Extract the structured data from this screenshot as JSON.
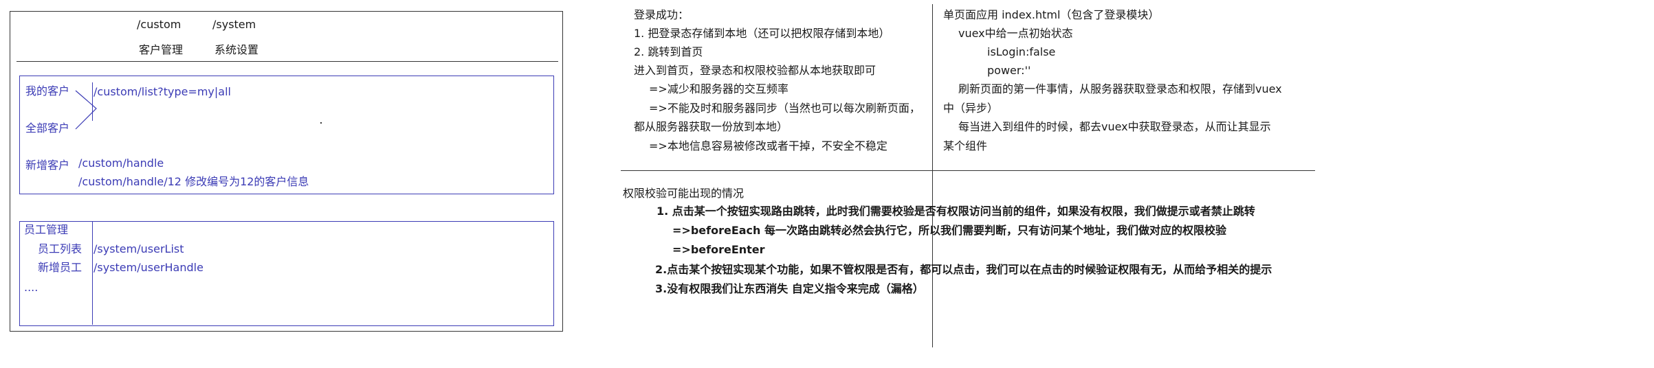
{
  "left_sketch": {
    "header_paths": [
      "/custom",
      "/system"
    ],
    "header_labels": [
      "客户管理",
      "系统设置"
    ],
    "customer_panel": {
      "nav": [
        "我的客户",
        "全部客户",
        "新增客户"
      ],
      "routes": [
        "/custom/list?type=my|all",
        "/custom/handle",
        "/custom/handle/12   修改编号为12的客户信息"
      ]
    },
    "staff_panel": {
      "nav": [
        "员工管理",
        "员工列表",
        "新增员工",
        "...."
      ],
      "routes": [
        "/system/userList",
        "/system/userHandle"
      ]
    }
  },
  "notes_left": [
    "登录成功：",
    "1. 把登录态存储到本地（还可以把权限存储到本地）",
    "2. 跳转到首页",
    "进入到首页，登录态和权限校验都从本地获取即可",
    "=>减少和服务器的交互频率",
    "=>不能及时和服务器同步（当然也可以每次刷新页面，",
    "都从服务器获取一份放到本地）",
    "=>本地信息容易被修改或者干掉，不安全不稳定"
  ],
  "notes_right": [
    "单页面应用    index.html（包含了登录模块）",
    "vuex中给一点初始状态",
    "isLogin:false",
    "power:''",
    "刷新页面的第一件事情，从服务器获取登录态和权限，存储到vuex",
    "中（异步）",
    "每当进入到组件的时候，都去vuex中获取登录态，从而让其显示",
    "某个组件"
  ],
  "notes_bottom": {
    "heading": "权限校验可能出现的情况",
    "lines": [
      "1. 点击某一个按钮实现路由跳转，此时我们需要校验是否有权限访问当前的组件，如果没有权限，我们做提示或者禁止跳转",
      "=>beforeEach    每一次路由跳转必然会执行它，所以我们需要判断，只有访问某个地址，我们做对应的权限校验",
      "=>beforeEnter",
      "2.点击某个按钮实现某个功能，如果不管权限是否有，都可以点击，我们可以在点击的时候验证权限有无，从而给予相关的提示",
      "3.没有权限我们让东西消失    自定义指令来完成（漏格）"
    ]
  }
}
